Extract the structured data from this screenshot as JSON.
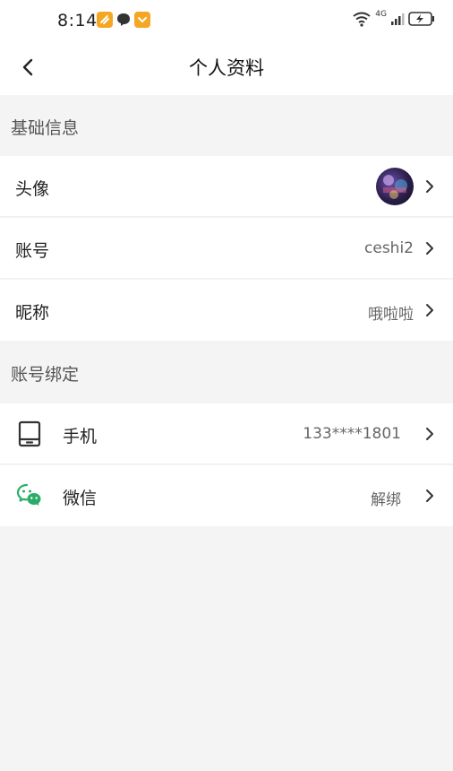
{
  "status_bar": {
    "time": "8:14",
    "network": "4G",
    "left_icons": [
      "app-badge-icon",
      "chat-bubble-icon",
      "app-badge-icon"
    ],
    "right_icons": [
      "wifi-icon",
      "signal-icon",
      "battery-icon"
    ]
  },
  "nav": {
    "title": "个人资料",
    "back_icon": "chevron-left-icon"
  },
  "sections": [
    {
      "header": "基础信息",
      "rows": [
        {
          "label": "头像",
          "value": "",
          "type": "avatar"
        },
        {
          "label": "账号",
          "value": "ceshi2"
        },
        {
          "label": "昵称",
          "value": "哦啦啦"
        }
      ]
    },
    {
      "header": "账号绑定",
      "rows": [
        {
          "label": "手机",
          "value": "133****1801",
          "icon": "phone-icon"
        },
        {
          "label": "微信",
          "value": "解绑",
          "icon": "wechat-icon"
        }
      ]
    }
  ],
  "colors": {
    "background": "#f4f4f4",
    "row_background": "#ffffff",
    "wechat_green": "#2aae67",
    "badge_orange": "#f5a623"
  }
}
